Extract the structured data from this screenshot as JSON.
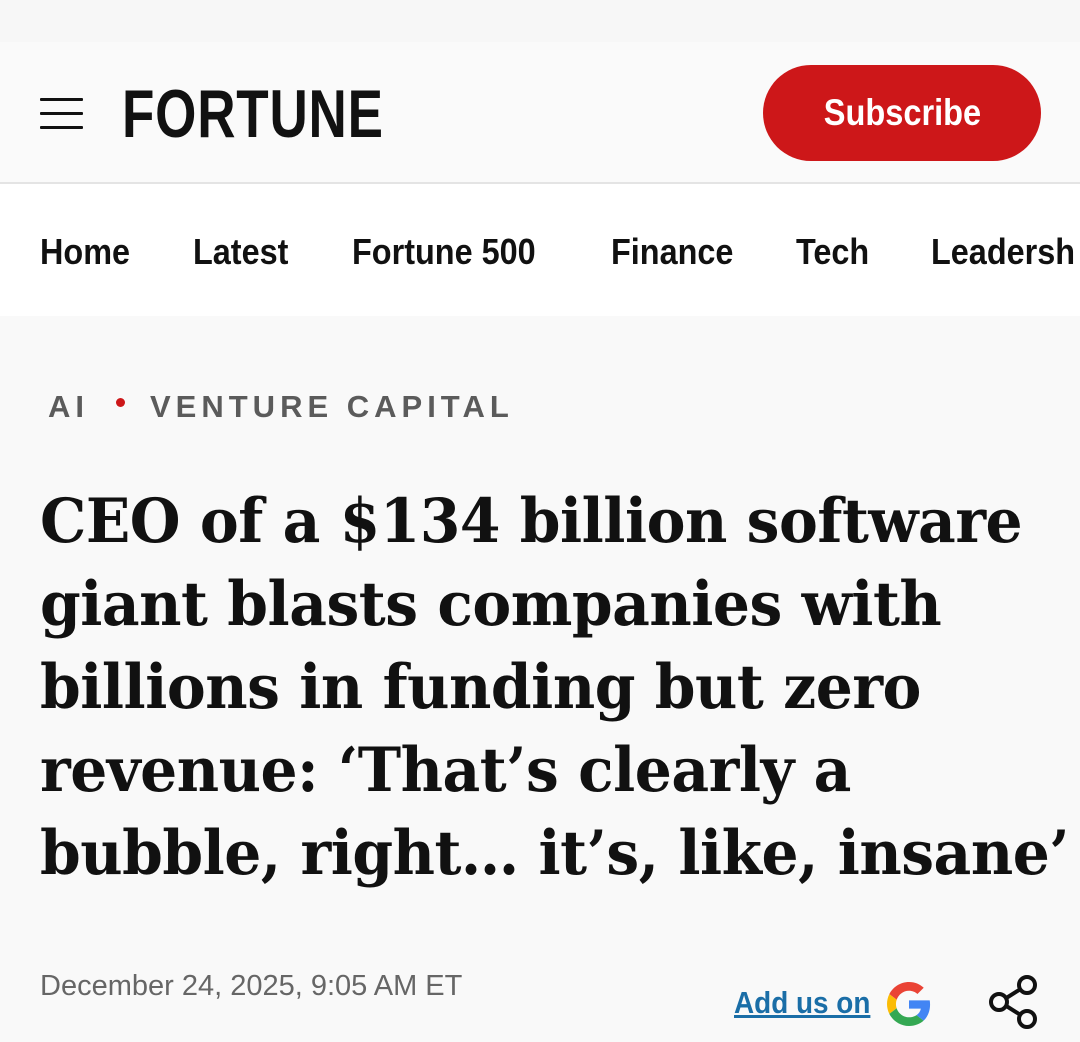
{
  "header": {
    "menu_icon": "hamburger-menu-icon",
    "logo": "FORTUNE",
    "subscribe_label": "Subscribe",
    "brand_color": "#cd1719"
  },
  "nav": {
    "items": [
      {
        "label": "Home"
      },
      {
        "label": "Latest"
      },
      {
        "label": "Fortune 500"
      },
      {
        "label": "Finance"
      },
      {
        "label": "Tech"
      },
      {
        "label": "Leadersh"
      }
    ]
  },
  "article": {
    "categories": [
      "AI",
      "VENTURE CAPITAL"
    ],
    "headline_lines": [
      "CEO of a $134 billion software",
      "giant blasts companies with",
      "billions in funding but zero",
      "revenue: ‘That’s clearly a",
      "bubble, right… it’s, like, insane’"
    ],
    "dateline": "December 24, 2025, 9:05 AM ET",
    "add_us_label": "Add us on",
    "google_icon": "google-g-icon",
    "share_icon": "share-icon",
    "link_color": "#1a6ea7"
  }
}
